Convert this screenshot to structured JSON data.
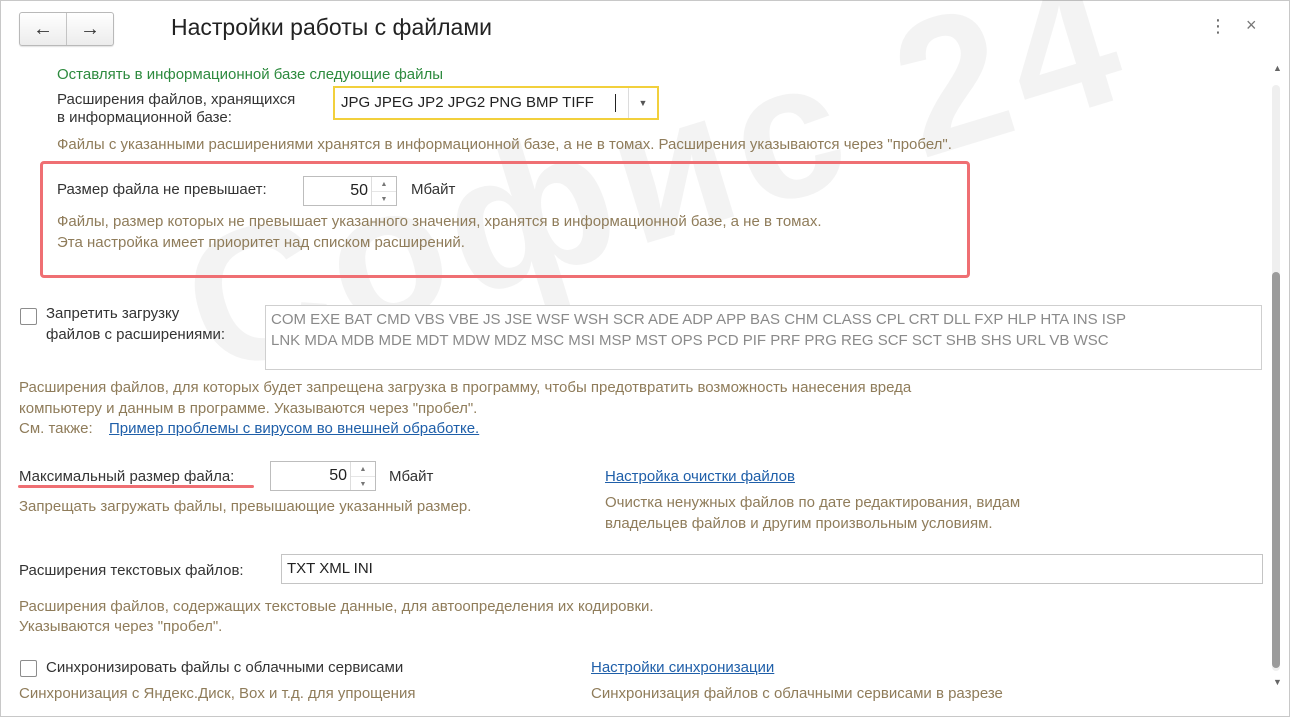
{
  "header": {
    "back_icon": "←",
    "forward_icon": "→",
    "title": "Настройки работы с файлами",
    "more_icon": "⋮",
    "close_icon": "×"
  },
  "watermark": "Софис 24",
  "ib_section": {
    "heading": "Оставлять в информационной базе следующие файлы",
    "ext_label_line1": "Расширения файлов, хранящихся",
    "ext_label_line2": "в информационной базе:",
    "ext_value": "JPG JPEG JP2 JPG2 PNG BMP TIFF",
    "ext_note": "Файлы с указанными расширениями хранятся в информационной базе, а не в томах. Расширения указываются через \"пробел\"."
  },
  "size_limit": {
    "label": "Размер файла не превышает:",
    "value": "50",
    "unit": "Мбайт",
    "note_line1": "Файлы, размер которых не превышает указанного значения, хранятся в информационной базе, а не в томах.",
    "note_line2": "Эта настройка имеет приоритет над списком расширений."
  },
  "forbid_upload": {
    "checked": false,
    "label_line1": "Запретить загрузку",
    "label_line2": "файлов с расширениями:",
    "extensions_line1": "COM EXE BAT CMD VBS VBE JS JSE WSF WSH SCR ADE ADP APP BAS CHM CLASS CPL CRT DLL FXP HLP HTA INS ISP",
    "extensions_line2": "LNK MDA MDB MDE MDT MDW MDZ MSC MSI MSP MST OPS PCD PIF PRF PRG REG SCF SCT SHB SHS URL VB WSC",
    "note_line1": "Расширения файлов, для которых будет запрещена загрузка в программу, чтобы предотвратить возможность нанесения вреда",
    "note_line2": "компьютеру и данным в программе. Указываются через \"пробел\".",
    "see_also": "См. также:",
    "see_also_link": "Пример проблемы с вирусом во внешней  обработке."
  },
  "max_size": {
    "label": "Максимальный размер файла:",
    "value": "50",
    "unit": "Мбайт",
    "note": "Запрещать загружать файлы, превышающие указанный размер."
  },
  "cleanup": {
    "link": "Настройка очистки файлов",
    "note_line1": "Очистка ненужных файлов по дате редактирования, видам",
    "note_line2": "владельцев файлов и другим произвольным условиям."
  },
  "text_ext": {
    "label": "Расширения текстовых файлов:",
    "value": "TXT XML INI",
    "note_line1": "Расширения файлов, содержащих текстовые данные, для автоопределения их кодировки.",
    "note_line2": "Указываются через \"пробел\"."
  },
  "cloud_sync": {
    "checked": false,
    "label": "Синхронизировать файлы с облачными сервисами",
    "note_partial": "Синхронизация с Яндекс.Диск, Box и т.д. для упрощения",
    "settings_link": "Настройки синхронизации",
    "settings_note_partial": "Синхронизация файлов с облачными сервисами в разрезе"
  },
  "scrollbar": {
    "up_icon": "▲",
    "down_icon": "▼"
  },
  "colors": {
    "accent_highlight": "#ef6f73",
    "green_heading": "#2d8a3e",
    "note_text": "#8f7c5a",
    "link": "#1f5fa9",
    "combo_border": "#f2d03c"
  }
}
